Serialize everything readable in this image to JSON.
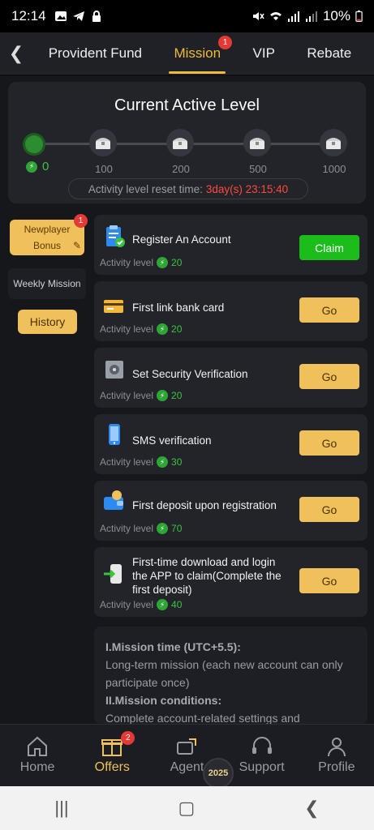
{
  "status": {
    "time": "12:14",
    "battery": "10%"
  },
  "topnav": {
    "tabs": [
      {
        "label": "Provident Fund"
      },
      {
        "label": "Mission",
        "badge": "1"
      },
      {
        "label": "VIP"
      },
      {
        "label": "Rebate"
      }
    ]
  },
  "level": {
    "title": "Current Active Level",
    "current": "0",
    "milestones": [
      "100",
      "200",
      "500",
      "1000"
    ],
    "reset_label": "Activity level reset time:",
    "reset_value": "3day(s) 23:15:40"
  },
  "sidebar": {
    "newplayer_line1": "Newplayer",
    "newplayer_line2": "Bonus",
    "newplayer_badge": "1",
    "weekly": "Weekly Mission",
    "history": "History"
  },
  "missions": [
    {
      "title": "Register An Account",
      "activity_label": "Activity level",
      "points": "20",
      "button": "Claim"
    },
    {
      "title": "First link bank card",
      "activity_label": "Activity level",
      "points": "20",
      "button": "Go"
    },
    {
      "title": "Set Security Verification",
      "activity_label": "Activity level",
      "points": "20",
      "button": "Go"
    },
    {
      "title": "SMS verification",
      "activity_label": "Activity level",
      "points": "30",
      "button": "Go"
    },
    {
      "title": "First deposit upon registration",
      "activity_label": "Activity level",
      "points": "70",
      "button": "Go"
    },
    {
      "title": "First-time download and login the APP to claim(Complete the first deposit)",
      "activity_label": "Activity level",
      "points": "40",
      "button": "Go"
    }
  ],
  "rules": {
    "h1": "I.Mission time (UTC+5.5):",
    "p1": "Long-term mission (each new account can only participate once)",
    "h2": "II.Mission conditions:",
    "p2": "Complete account-related settings and"
  },
  "bottomnav": {
    "items": [
      {
        "label": "Home"
      },
      {
        "label": "Offers",
        "badge": "2"
      },
      {
        "label": "Agent"
      },
      {
        "label": "Support"
      },
      {
        "label": "Profile"
      }
    ],
    "badge_2025": "2025"
  },
  "colors": {
    "accent": "#f0c15a",
    "green": "#39c43e",
    "red": "#ff4a3d",
    "claim": "#1bbd1b"
  }
}
